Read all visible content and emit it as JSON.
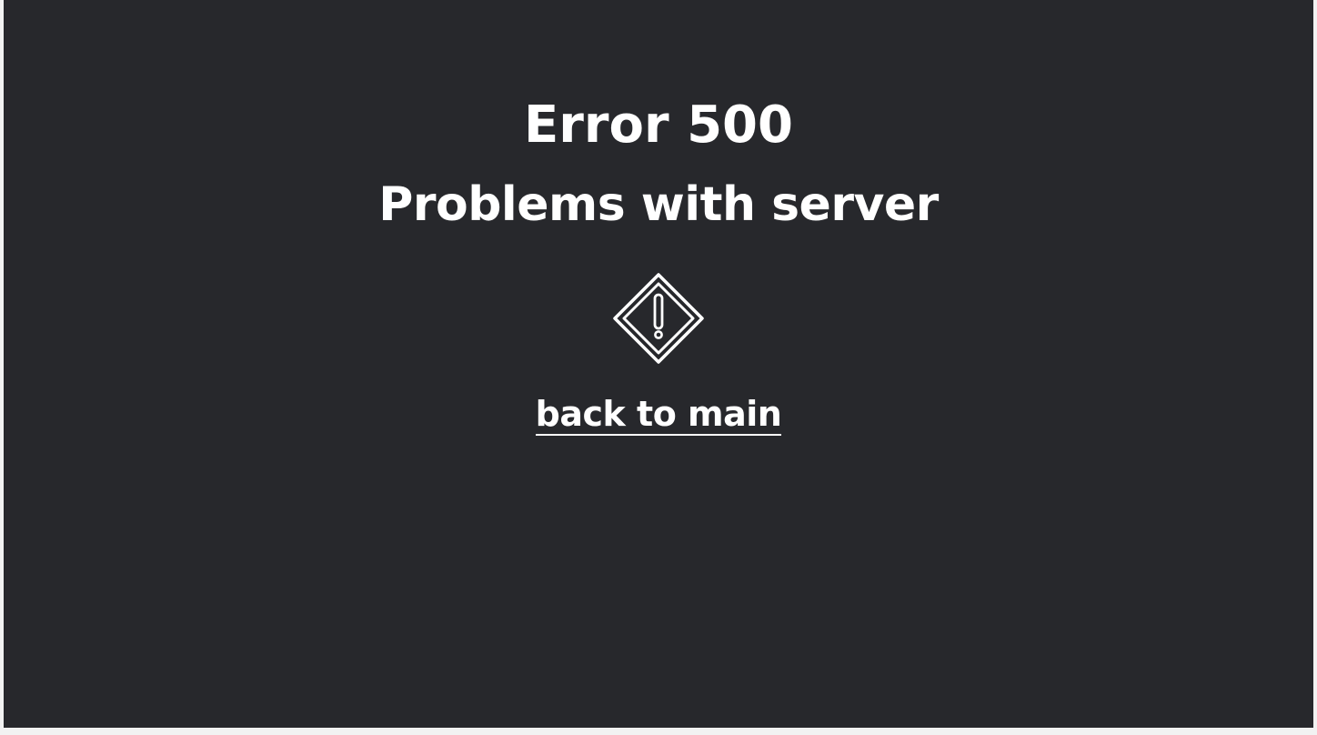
{
  "error": {
    "title": "Error 500",
    "message": "Problems with server",
    "icon": "warning-diamond-icon",
    "link_label": "back to main"
  },
  "colors": {
    "background": "#27282c",
    "text": "#ffffff"
  }
}
